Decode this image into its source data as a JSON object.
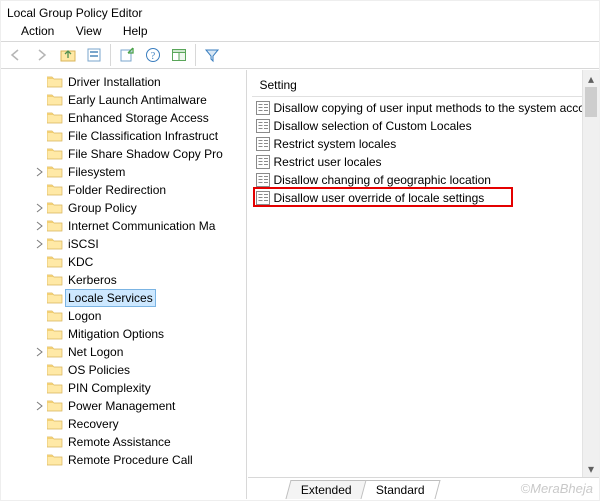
{
  "window": {
    "title": "Local Group Policy Editor"
  },
  "menu": {
    "action": "Action",
    "view": "View",
    "help": "Help"
  },
  "toolbar": {
    "back": "back-icon",
    "forward": "forward-icon",
    "up": "up-icon",
    "options": "options-icon",
    "export": "export-icon",
    "help": "help-icon",
    "pane": "preview-pane-icon",
    "filter": "filter-icon"
  },
  "tree": {
    "items": [
      {
        "label": "Driver Installation",
        "expandable": false
      },
      {
        "label": "Early Launch Antimalware",
        "expandable": false
      },
      {
        "label": "Enhanced Storage Access",
        "expandable": false
      },
      {
        "label": "File Classification Infrastruct",
        "expandable": false
      },
      {
        "label": "File Share Shadow Copy Pro",
        "expandable": false
      },
      {
        "label": "Filesystem",
        "expandable": true
      },
      {
        "label": "Folder Redirection",
        "expandable": false
      },
      {
        "label": "Group Policy",
        "expandable": true
      },
      {
        "label": "Internet Communication Ma",
        "expandable": true
      },
      {
        "label": "iSCSI",
        "expandable": true
      },
      {
        "label": "KDC",
        "expandable": false
      },
      {
        "label": "Kerberos",
        "expandable": false
      },
      {
        "label": "Locale Services",
        "expandable": false,
        "selected": true
      },
      {
        "label": "Logon",
        "expandable": false
      },
      {
        "label": "Mitigation Options",
        "expandable": false
      },
      {
        "label": "Net Logon",
        "expandable": true
      },
      {
        "label": "OS Policies",
        "expandable": false
      },
      {
        "label": "PIN Complexity",
        "expandable": false
      },
      {
        "label": "Power Management",
        "expandable": true
      },
      {
        "label": "Recovery",
        "expandable": false
      },
      {
        "label": "Remote Assistance",
        "expandable": false
      },
      {
        "label": "Remote Procedure Call",
        "expandable": false
      }
    ]
  },
  "grid": {
    "header": "Setting",
    "rows": [
      {
        "label": "Disallow copying of user input methods to the system acco..."
      },
      {
        "label": "Disallow selection of Custom Locales"
      },
      {
        "label": "Restrict system locales"
      },
      {
        "label": "Restrict user locales"
      },
      {
        "label": "Disallow changing of geographic location"
      },
      {
        "label": "Disallow user override of locale settings",
        "highlighted": true
      }
    ]
  },
  "tabs": {
    "extended": "Extended",
    "standard": "Standard"
  },
  "watermark": "©MeraBheja"
}
